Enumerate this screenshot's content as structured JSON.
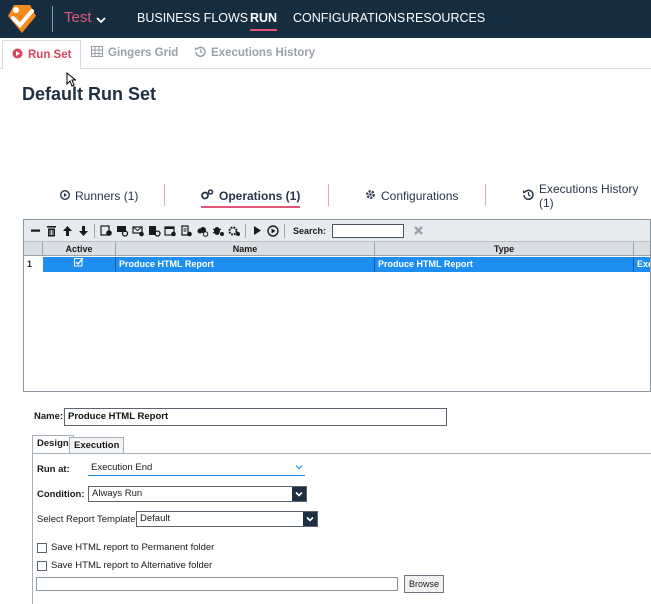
{
  "app": {
    "solution_name": "Test"
  },
  "top_nav": {
    "items": [
      {
        "label": "BUSINESS FLOWS"
      },
      {
        "label": "RUN"
      },
      {
        "label": "CONFIGURATIONS"
      },
      {
        "label": "RESOURCES"
      }
    ]
  },
  "sub_tabs": [
    {
      "label": "Run Set"
    },
    {
      "label": "Gingers Grid"
    },
    {
      "label": "Executions History"
    }
  ],
  "page_title": "Default Run Set",
  "section_tabs": [
    {
      "label": "Runners (1)"
    },
    {
      "label": "Operations (1)"
    },
    {
      "label": "Configurations"
    },
    {
      "label": "Executions History (1)"
    }
  ],
  "grid": {
    "search_label": "Search:",
    "search_value": "",
    "columns": [
      "Active",
      "Name",
      "Type"
    ],
    "rows": [
      {
        "index": "1",
        "name": "Produce HTML Report",
        "type": "Produce HTML Report",
        "extra": "Exec"
      }
    ]
  },
  "details": {
    "name_label": "Name:",
    "name_value": "Produce HTML Report",
    "tabs": [
      {
        "label": "Design"
      },
      {
        "label": "Execution"
      }
    ],
    "run_at_label": "Run at:",
    "run_at_value": "Execution End",
    "condition_label": "Condition:",
    "condition_value": "Always Run",
    "template_label": "Select Report Template:",
    "template_value": "Default",
    "permanent_label": "Save HTML report to Permanent folder",
    "alternative_label": "Save HTML report to Alternative folder",
    "alt_path_value": "",
    "browse_label": "Browse"
  },
  "colors": {
    "top_bar": "#162d3f",
    "accent": "#e0557a",
    "selection": "#1e8ef0"
  }
}
